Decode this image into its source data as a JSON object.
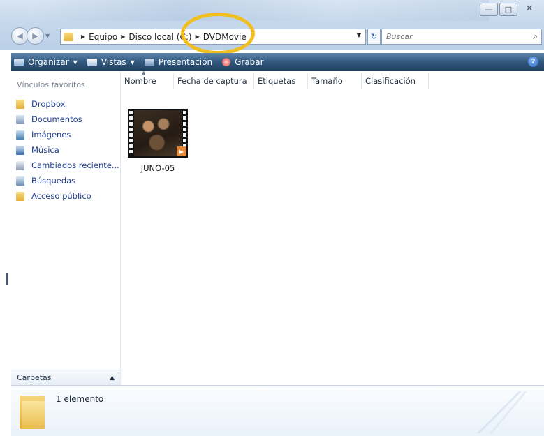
{
  "window": {
    "minimize_glyph": "—",
    "maximize_glyph": "□",
    "close_glyph": "✕"
  },
  "address": {
    "crumbs": [
      "Equipo",
      "Disco local (C:)",
      "DVDMovie"
    ]
  },
  "search": {
    "placeholder": "Buscar"
  },
  "toolbar": {
    "organize": "Organizar",
    "views": "Vistas",
    "slideshow": "Presentación",
    "burn": "Grabar"
  },
  "sidebar": {
    "title": "Vínculos favoritos",
    "items": [
      {
        "label": "Dropbox",
        "icon": "folder-icon"
      },
      {
        "label": "Documentos",
        "icon": "documents-icon"
      },
      {
        "label": "Imágenes",
        "icon": "pictures-icon"
      },
      {
        "label": "Música",
        "icon": "music-icon"
      },
      {
        "label": "Cambiados reciente...",
        "icon": "recent-icon"
      },
      {
        "label": "Búsquedas",
        "icon": "searches-icon"
      },
      {
        "label": "Acceso público",
        "icon": "public-folder-icon"
      }
    ],
    "folders_label": "Carpetas"
  },
  "columns": [
    "Nombre",
    "Fecha de captura",
    "Etiquetas",
    "Tamaño",
    "Clasificación"
  ],
  "files": [
    {
      "name": "JUNO-05",
      "type": "video"
    }
  ],
  "details": {
    "count": "1 elemento"
  },
  "colors": {
    "toolbar": "#2f5579",
    "link": "#1f3d8f",
    "callout": "#f2be1d"
  }
}
